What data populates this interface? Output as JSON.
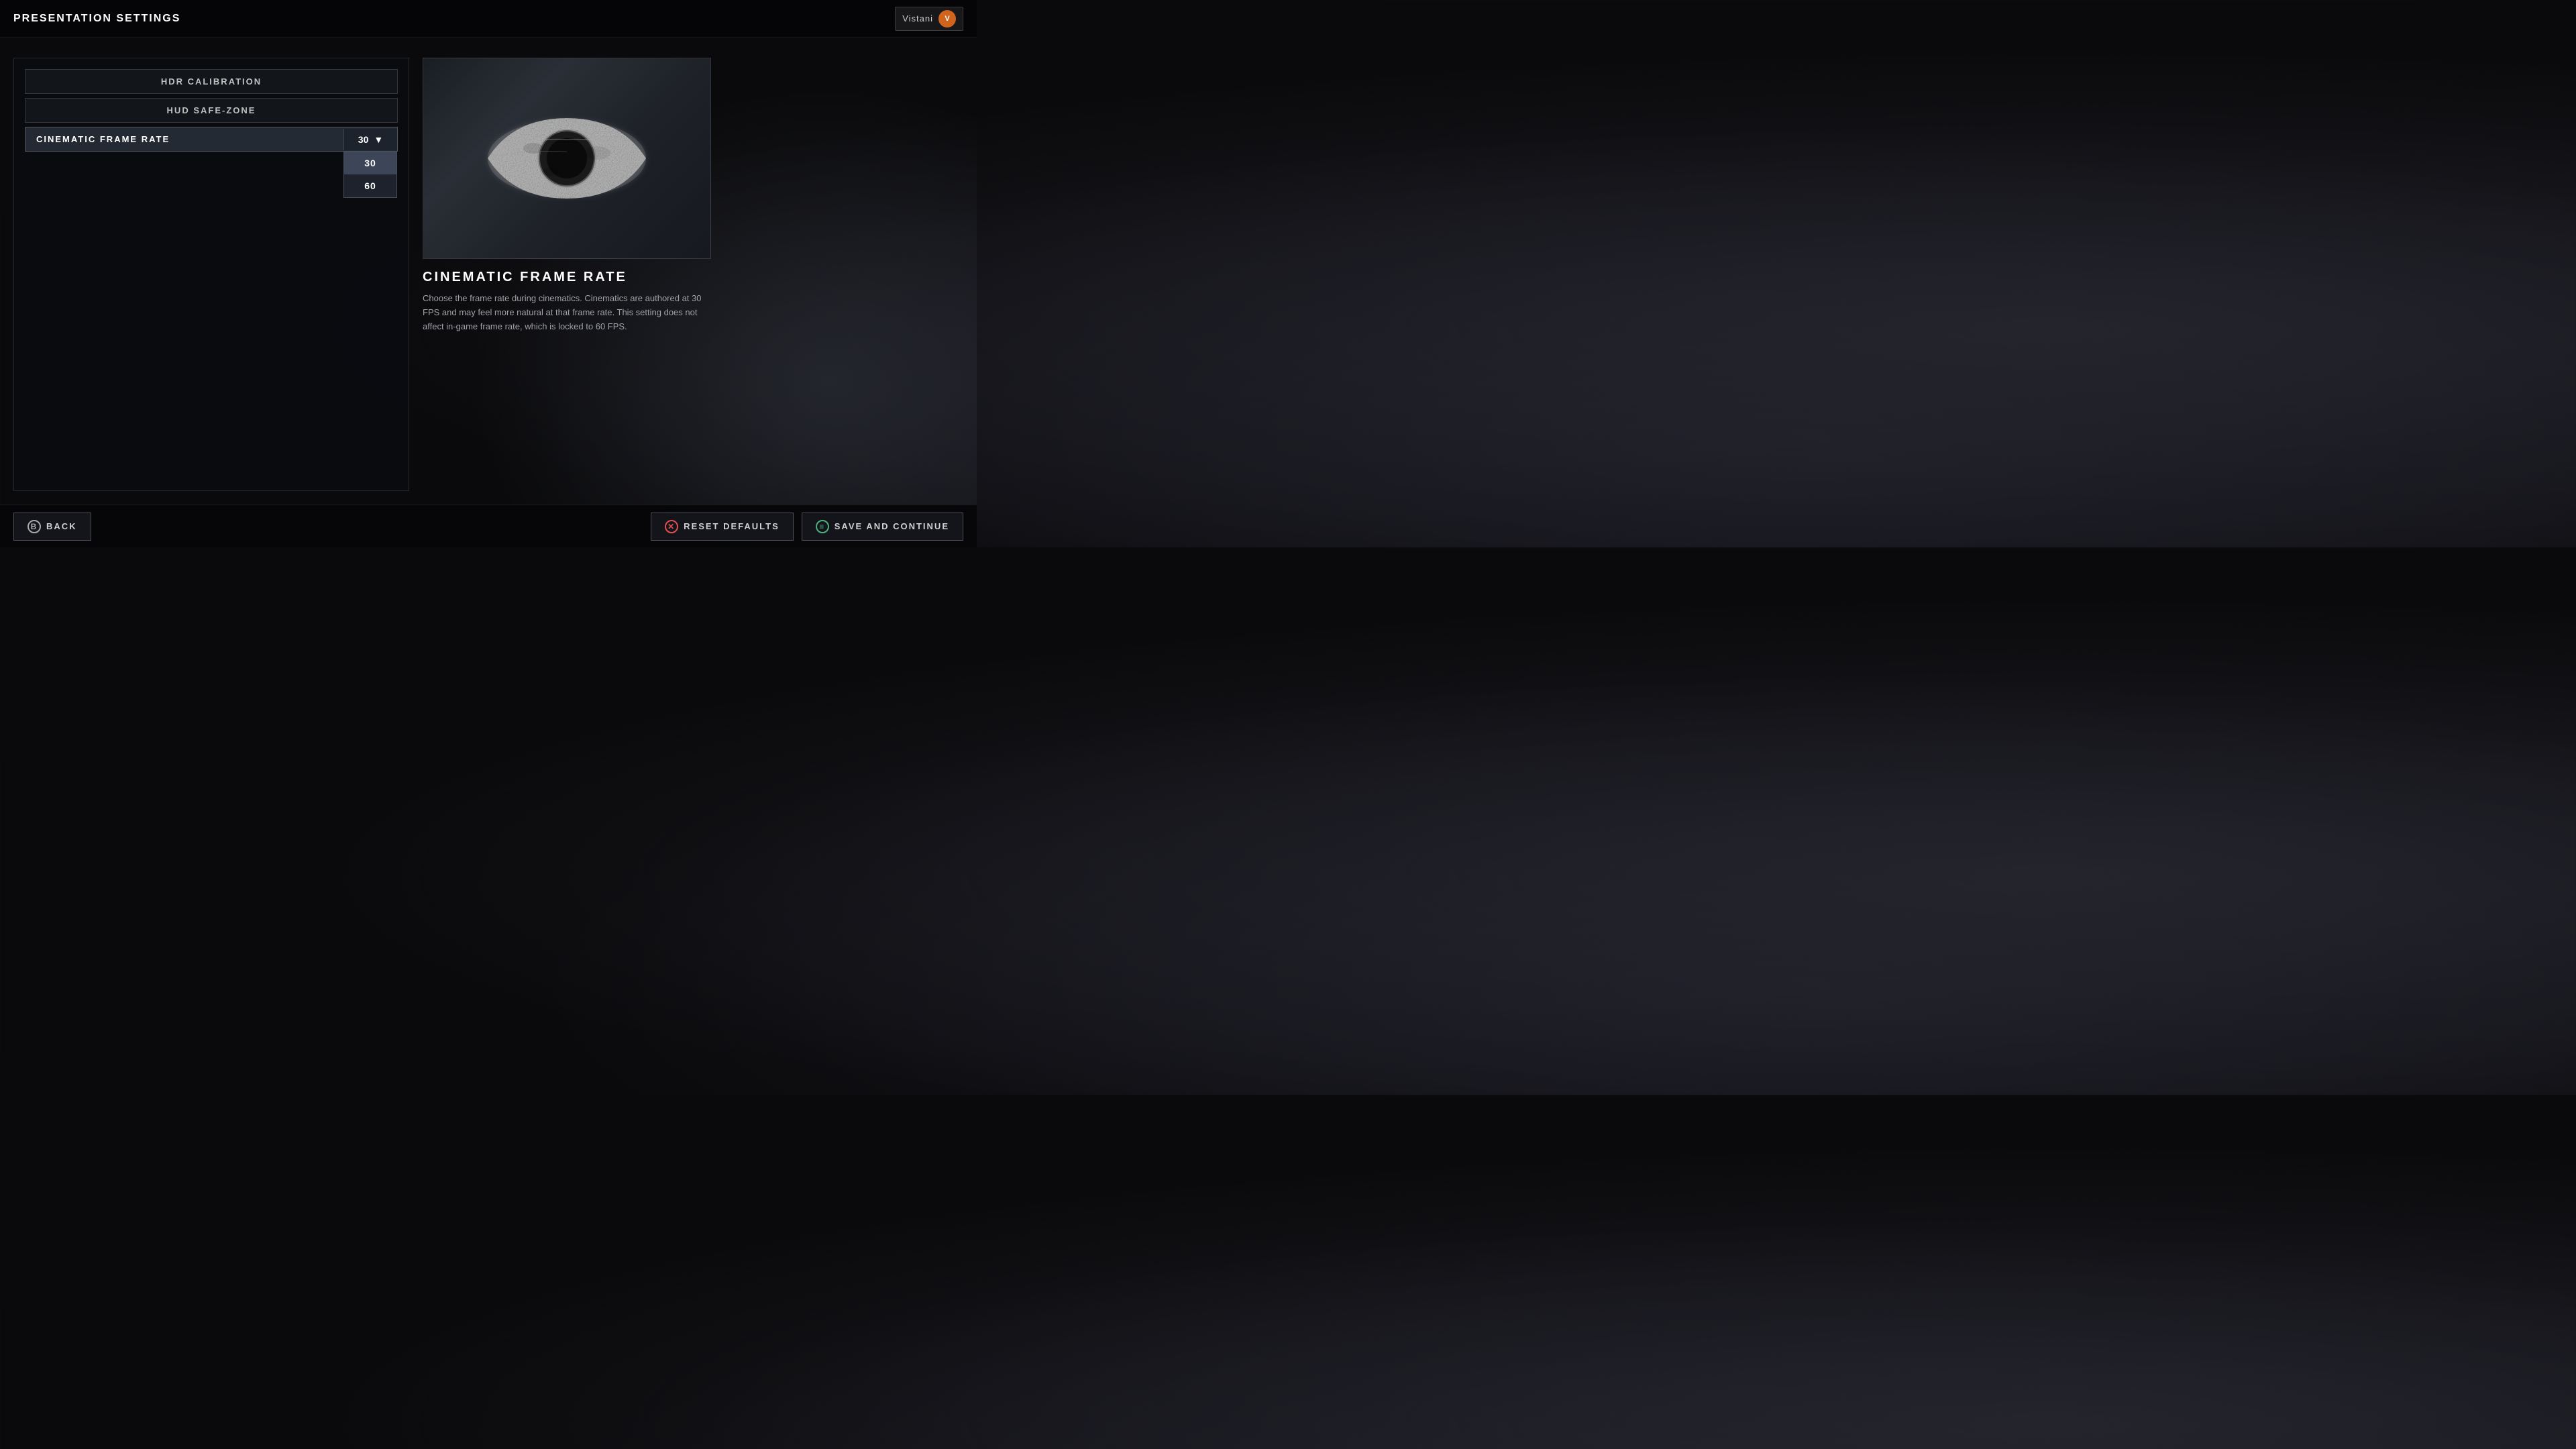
{
  "header": {
    "title": "PRESENTATION SETTINGS",
    "username": "Vistani"
  },
  "menu": {
    "items": [
      {
        "id": "hdr-calibration",
        "label": "HDR CALIBRATION",
        "active": false
      },
      {
        "id": "hud-safe-zone",
        "label": "HUD SAFE-ZONE",
        "active": false
      }
    ],
    "dropdown": {
      "label": "CINEMATIC FRAME RATE",
      "selected_value": "30",
      "options": [
        {
          "value": "30",
          "selected": true
        },
        {
          "value": "60",
          "selected": false
        }
      ]
    }
  },
  "detail": {
    "title": "CINEMATIC FRAME RATE",
    "description": "Choose the frame rate during cinematics. Cinematics are authored at 30 FPS and may feel more natural at that frame rate. This setting does not affect in-game frame rate, which is locked to 60 FPS."
  },
  "buttons": {
    "back": "BACK",
    "reset": "RESET DEFAULTS",
    "save": "SAVE AND CONTINUE"
  },
  "icons": {
    "back_icon": "B",
    "reset_icon": "✕",
    "save_icon": "≡"
  }
}
